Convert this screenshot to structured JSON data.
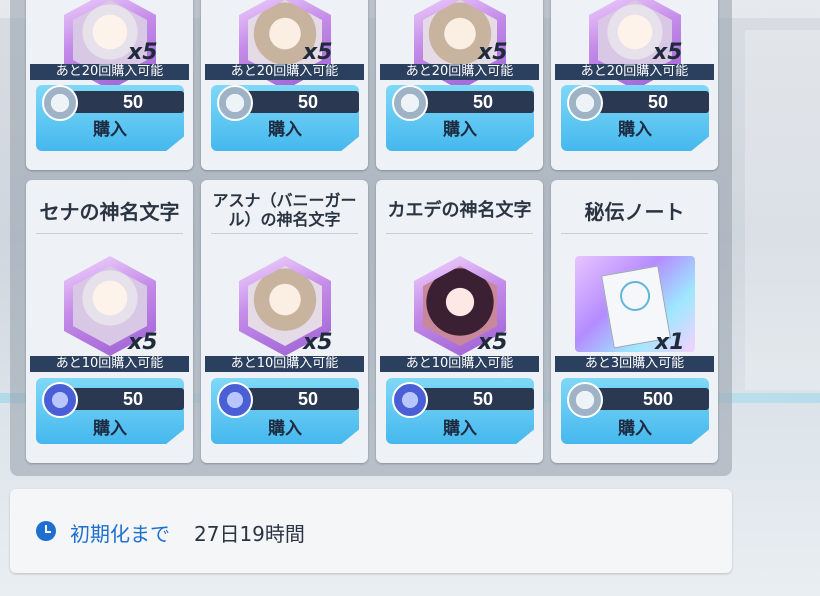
{
  "shop": {
    "top_row": [
      {
        "quantity": "x5",
        "limit": "あと20回購入可能",
        "price": "50",
        "currency_icon": "silver-gem-icon",
        "buy_label": "購入"
      },
      {
        "quantity": "x5",
        "limit": "あと20回購入可能",
        "price": "50",
        "currency_icon": "silver-gem-icon",
        "buy_label": "購入"
      },
      {
        "quantity": "x5",
        "limit": "あと20回購入可能",
        "price": "50",
        "currency_icon": "silver-gem-icon",
        "buy_label": "購入"
      },
      {
        "quantity": "x5",
        "limit": "あと20回購入可能",
        "price": "50",
        "currency_icon": "silver-gem-icon",
        "buy_label": "購入"
      }
    ],
    "bottom_row": [
      {
        "name": "セナの神名文字",
        "quantity": "x5",
        "limit": "あと10回購入可能",
        "price": "50",
        "currency_icon": "blue-gem-icon",
        "buy_label": "購入"
      },
      {
        "name": "アスナ（バニーガール）の神名文字",
        "quantity": "x5",
        "limit": "あと10回購入可能",
        "price": "50",
        "currency_icon": "blue-gem-icon",
        "buy_label": "購入"
      },
      {
        "name": "カエデの神名文字",
        "quantity": "x5",
        "limit": "あと10回購入可能",
        "price": "50",
        "currency_icon": "blue-gem-icon",
        "buy_label": "購入"
      },
      {
        "name": "秘伝ノート",
        "quantity": "x1",
        "limit": "あと3回購入可能",
        "price": "500",
        "currency_icon": "silver-gem-icon",
        "buy_label": "購入"
      }
    ]
  },
  "footer": {
    "reset_label": "初期化まで",
    "reset_value": "27日19時間"
  }
}
